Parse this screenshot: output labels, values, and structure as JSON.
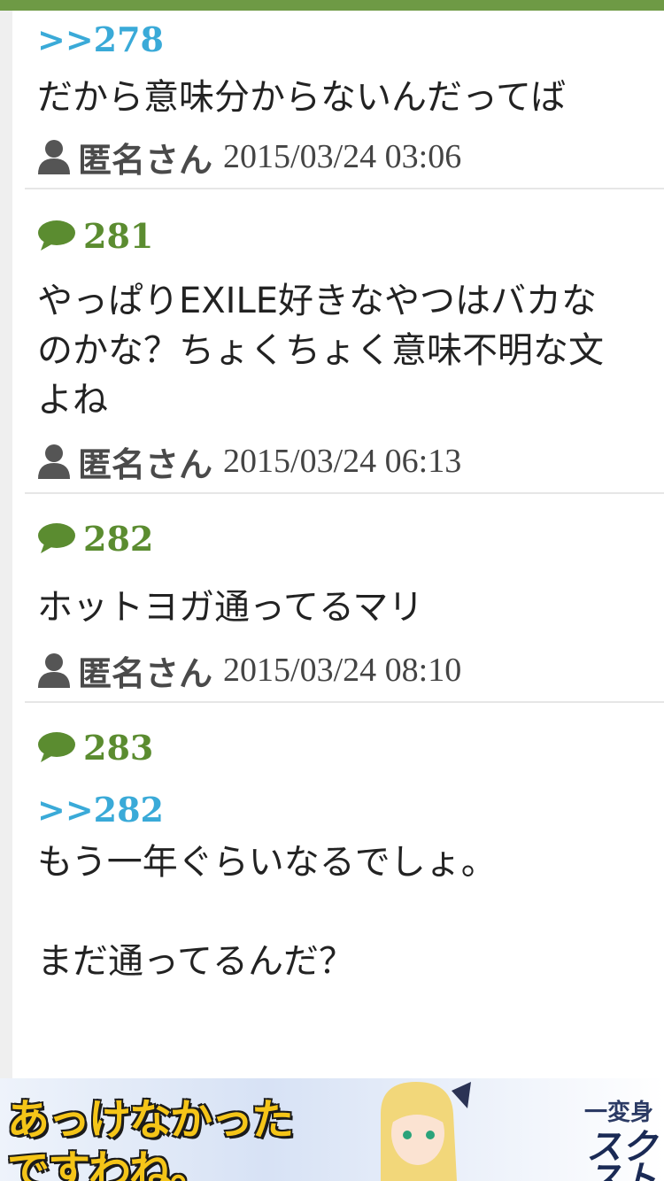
{
  "posts": [
    {
      "number": "",
      "reply": ">>278",
      "body": "だから意味分からないんだってば",
      "author": "匿名さん",
      "date": "2015/03/24 03:06"
    },
    {
      "number": "281",
      "reply": "",
      "body": "やっぱりEXILE好きなやつはバカな\nのかな？ちょくちょく意味不明な文\nよね",
      "author": "匿名さん",
      "date": "2015/03/24 06:13"
    },
    {
      "number": "282",
      "reply": "",
      "body": "ホットヨガ通ってるマリ",
      "author": "匿名さん",
      "date": "2015/03/24 08:10"
    },
    {
      "number": "283",
      "reply": ">>282",
      "body": "もう一年ぐらいなるでしょ。\n\nまだ通ってるんだ？",
      "author": "",
      "date": ""
    }
  ],
  "ad": {
    "headline": "あっけなかった\nですわね。",
    "side_text": "一変身",
    "logo_text": "スク\nスト"
  },
  "icons": {
    "comment": "comment-bubble-icon",
    "user": "user-icon"
  },
  "colors": {
    "accent_green": "#5b8c30",
    "reply_blue": "#3aaad8",
    "top_bar": "#6e9a45"
  }
}
